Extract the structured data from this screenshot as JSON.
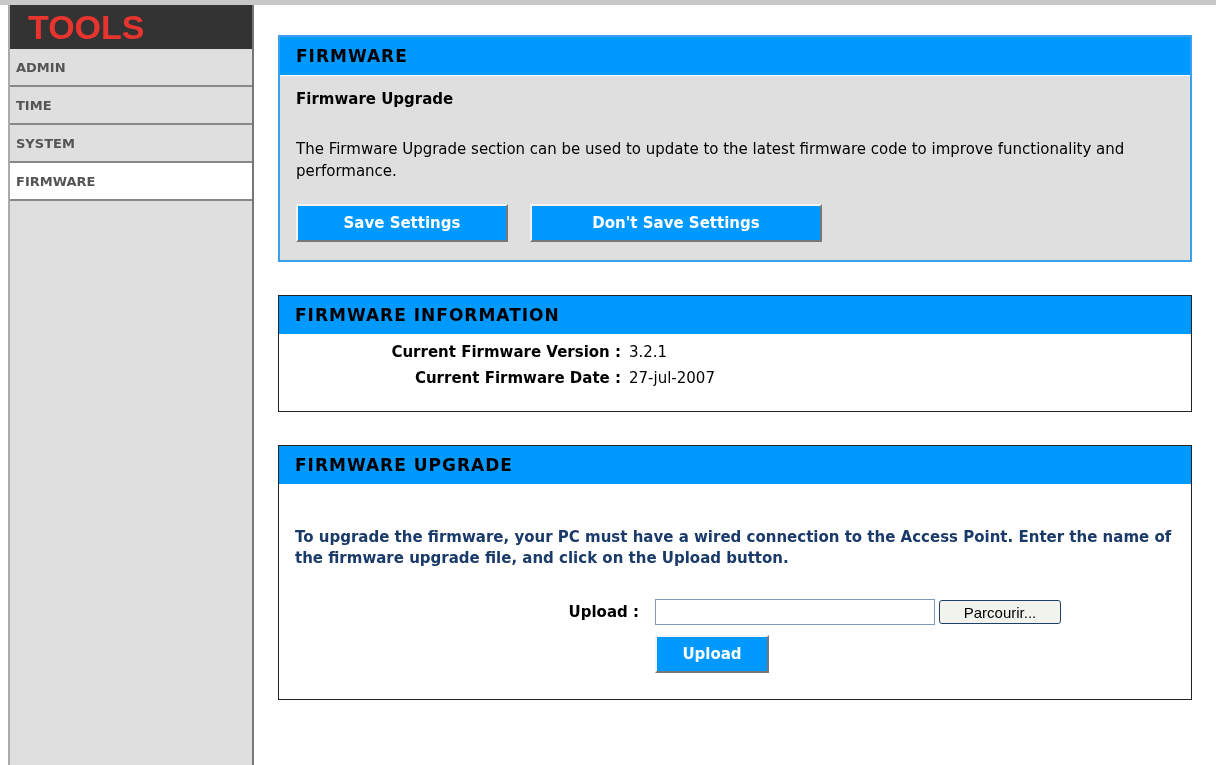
{
  "sidebar": {
    "title": "TOOLS",
    "items": [
      {
        "label": "ADMIN",
        "selected": false
      },
      {
        "label": "TIME",
        "selected": false
      },
      {
        "label": "SYSTEM",
        "selected": false
      },
      {
        "label": "FIRMWARE",
        "selected": true
      }
    ]
  },
  "firmware": {
    "title": "FIRMWARE",
    "subtitle": "Firmware Upgrade",
    "description": "The Firmware Upgrade section can be used to update to the latest firmware code to improve functionality and performance.",
    "buttons": [
      "Save Settings",
      "Don't Save Settings"
    ]
  },
  "firmware_information": {
    "title": "FIRMWARE INFORMATION",
    "rows": [
      {
        "label": "Current Firmware Version :",
        "value": "3.2.1"
      },
      {
        "label": "Current Firmware Date :",
        "value": "27-jul-2007"
      }
    ]
  },
  "firmware_upgrade": {
    "title": "FIRMWARE UPGRADE",
    "instructions": "To upgrade the firmware, your PC must have a wired connection to the Access Point. Enter the name of the firmware upgrade file, and click on the Upload button.",
    "upload_label": "Upload :",
    "browse_button": "Parcourir...",
    "upload_button": "Upload"
  }
}
